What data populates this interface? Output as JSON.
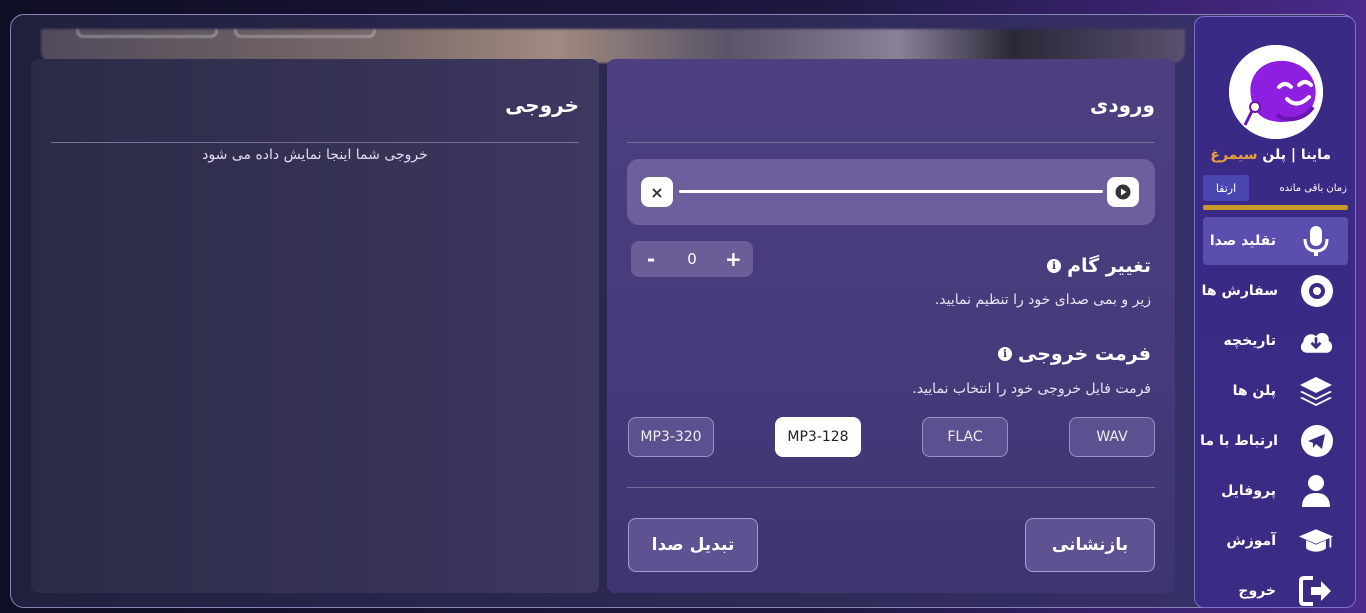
{
  "sidebar": {
    "brand": "ماینا | پلن",
    "plan_name": "سیمرغ",
    "remaining_label": "زمان باقی مانده",
    "upgrade_label": "ارتقا",
    "items": [
      {
        "label": "تقلید صدا",
        "icon": "microphone-icon",
        "active": true
      },
      {
        "label": "سفارش ها",
        "icon": "disc-icon"
      },
      {
        "label": "تاریخچه",
        "icon": "cloud-download-icon"
      },
      {
        "label": "پلن ها",
        "icon": "layers-icon"
      },
      {
        "label": "ارتباط با ما",
        "icon": "telegram-icon"
      },
      {
        "label": "پروفایل",
        "icon": "user-icon"
      },
      {
        "label": "آموزش",
        "icon": "graduation-cap-icon"
      },
      {
        "label": "خروج",
        "icon": "logout-icon"
      }
    ]
  },
  "input_panel": {
    "title": "ورودی",
    "player": {
      "clear_symbol": "×"
    },
    "pitch": {
      "title": "تغییر گام",
      "info_symbol": "i",
      "description": "زیر و بمی صدای خود را تنظیم نمایید.",
      "minus": "-",
      "value": "0",
      "plus": "+"
    },
    "format": {
      "title": "فرمت خروجی",
      "info_symbol": "i",
      "description": "فرمت فایل خروجی خود را انتخاب نمایید.",
      "options": [
        "WAV",
        "FLAC",
        "MP3-128",
        "MP3-320"
      ],
      "selected": "MP3-128"
    },
    "reset_label": "بازنشانی",
    "convert_label": "تبدیل صدا"
  },
  "output_panel": {
    "title": "خروجی",
    "placeholder": "خروجی شما اینجا نمایش داده می شود"
  },
  "colors": {
    "accent_gold": "#c89a2c",
    "plan_accent": "#e8a23c",
    "active_nav": "#5a4fae",
    "logo_purple": "#8e1fe0"
  }
}
